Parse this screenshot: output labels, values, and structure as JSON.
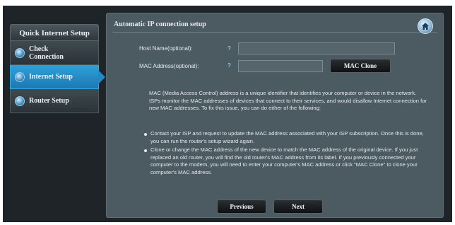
{
  "sidebar": {
    "header": "Quick Internet Setup",
    "items": [
      {
        "label": "Check Connection",
        "active": false
      },
      {
        "label": "Internet Setup",
        "active": true
      },
      {
        "label": "Router Setup",
        "active": false
      }
    ]
  },
  "panel": {
    "title": "Automatic IP connection setup",
    "home_icon": "home-icon"
  },
  "form": {
    "host_name_label": "Host Name(optional):",
    "host_name_value": "",
    "mac_label": "MAC Address(optional):",
    "mac_value": "",
    "help_glyph": "?",
    "mac_clone_label": "MAC Clone"
  },
  "description": "MAC (Media Access Control) address is a unique identifier that identifies your computer or device in the network. ISPs monitor the MAC addresses of devices that connect to their services, and would disallow Internet connection for new MAC addresses. To fix this issue, you can do either of the following:",
  "bullets": [
    "Contact your ISP and request to update the MAC address associated with your ISP subscription. Once this is done, you can run the router's setup wizard again.",
    "Clone or change the MAC address of the new device to match the MAC address of the original device. If you just replaced an old router, you will find the old router's MAC address from its label. If you previously connected your computer to the modem, you will need to enter your computer's MAC address or click \"MAC Clone\" to clone your computer's MAC address."
  ],
  "buttons": {
    "previous": "Previous",
    "next": "Next"
  },
  "colors": {
    "active_tab": "#2488c4",
    "panel_bg": "#4c5a61",
    "frame_bg": "#1f2428"
  }
}
